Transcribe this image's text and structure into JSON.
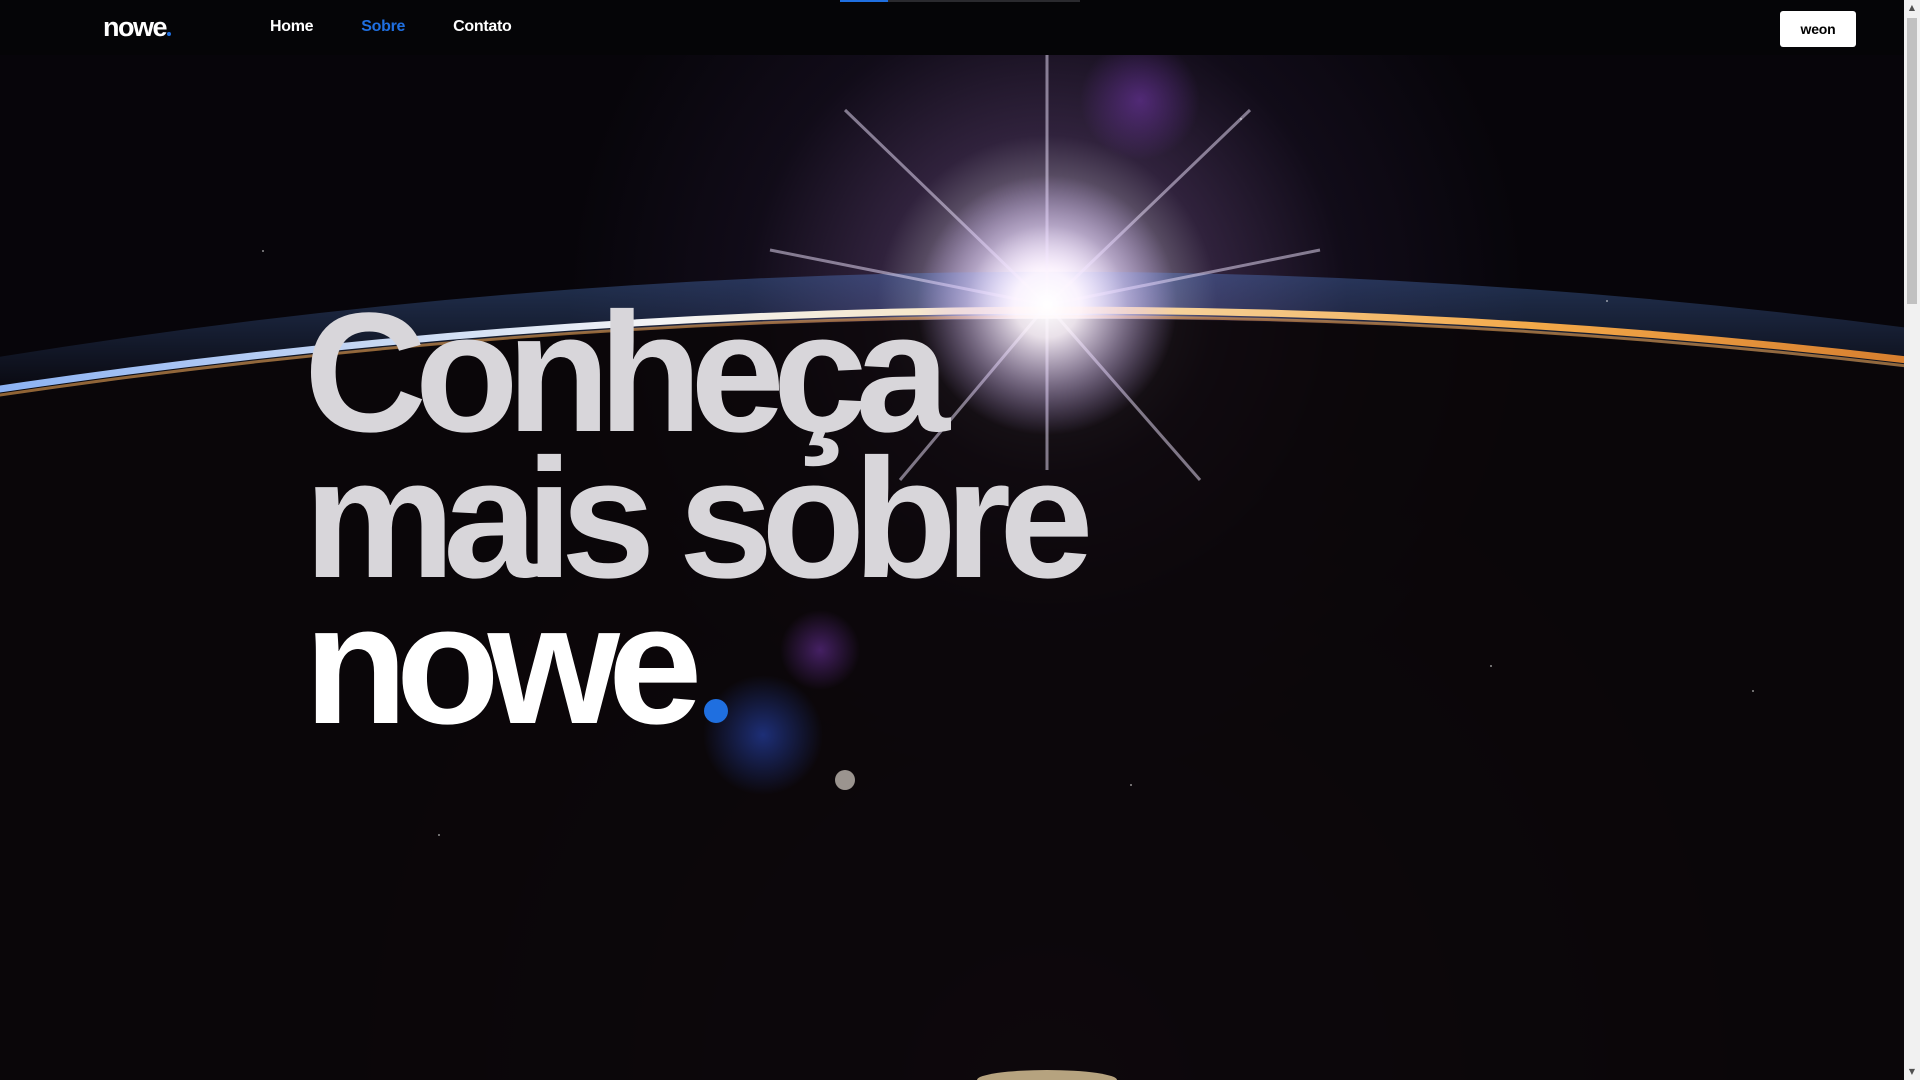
{
  "nav": {
    "logo": "nowe",
    "links": [
      {
        "label": "Home",
        "active": false
      },
      {
        "label": "Sobre",
        "active": true
      },
      {
        "label": "Contato",
        "active": false
      }
    ],
    "login_label": "weon",
    "scroll_progress": 0.2
  },
  "hero": {
    "line1": "Conheça",
    "line2": "mais sobre",
    "line3": "nowe"
  },
  "colors": {
    "accent": "#1f6fe0",
    "nav_background": "#050507",
    "headline_grey": "#d8d6da",
    "headline_white": "#ffffff"
  },
  "icons": {
    "scroll_up": "triangle-up-icon",
    "scroll_down": "triangle-down-icon"
  }
}
